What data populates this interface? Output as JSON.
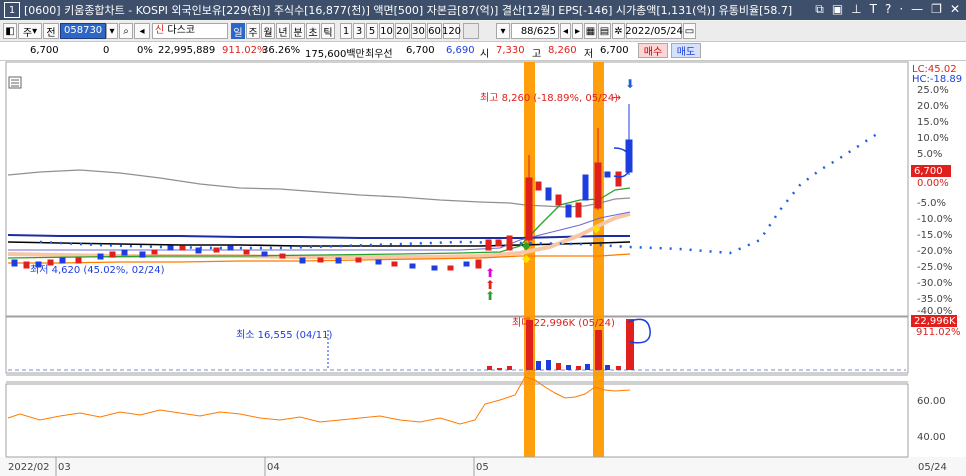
{
  "window": {
    "number": "1",
    "title": "[0600] 키움종합차트 - KOSPI 외국인보유[229(천)] 주식수[16,877(천)] 액면[500] 자본금[87(억)] 결산[12월] EPS[-146] 시가총액[1,131(억)] 유통비율[58.7]"
  },
  "toolbar": {
    "market": "주",
    "scope": "전",
    "code": "058730",
    "name_prefix": "신",
    "name": "다스코",
    "periods": [
      "일",
      "주",
      "월",
      "년",
      "분",
      "초",
      "틱"
    ],
    "selected_period": "일",
    "intervals": [
      "1",
      "3",
      "5",
      "10",
      "20",
      "30",
      "60",
      "120"
    ],
    "count": "88/625",
    "date": "2022/05/24"
  },
  "info": {
    "price": "6,700",
    "change": "0",
    "change_pct": "0%",
    "volume": "22,995,889",
    "volume_ratio": "911.02%",
    "turnover": "36.26%",
    "amount": "175,600백만",
    "best_bid_label": "최우선",
    "best_ask": "6,700",
    "best_bid": "6,690",
    "open_label": "시",
    "open": "7,330",
    "high_label": "고",
    "high": "8,260",
    "low_label": "저",
    "low": "6,700",
    "buy_label": "매수",
    "sell_label": "매도"
  },
  "chart": {
    "price_axis_header1": "LC:45.02",
    "price_axis_header2": "HC:-18.89",
    "price_ticks": [
      "25.0%",
      "20.0%",
      "15.0%",
      "10.0%",
      "5.0%",
      "0.0%",
      "-5.0%",
      "-10.0%",
      "-15.0%",
      "-20.0%",
      "-25.0%",
      "-30.0%",
      "-35.0%",
      "-40.0%"
    ],
    "current_price_badge": "6,700",
    "current_pct": "0.00%",
    "high_annotation": "최고 8,260 (-18.89%, 05/24)",
    "low_annotation": "최저 4,620 (45.02%, 02/24)",
    "volume_max_annotation": "최대 22,996K (05/24)",
    "volume_min_annotation": "최소 16,555 (04/11)",
    "volume_badge": "22,996K",
    "volume_badge_pct": "911.02%",
    "osc_ticks": [
      "60.00",
      "40.00"
    ],
    "x_labels": [
      "2022/02",
      "03",
      "04",
      "05"
    ],
    "x_right_label": "05/24"
  },
  "colors": {
    "up": "#e0201c",
    "down": "#1c3ee0",
    "highlight": "#ff9a00"
  }
}
